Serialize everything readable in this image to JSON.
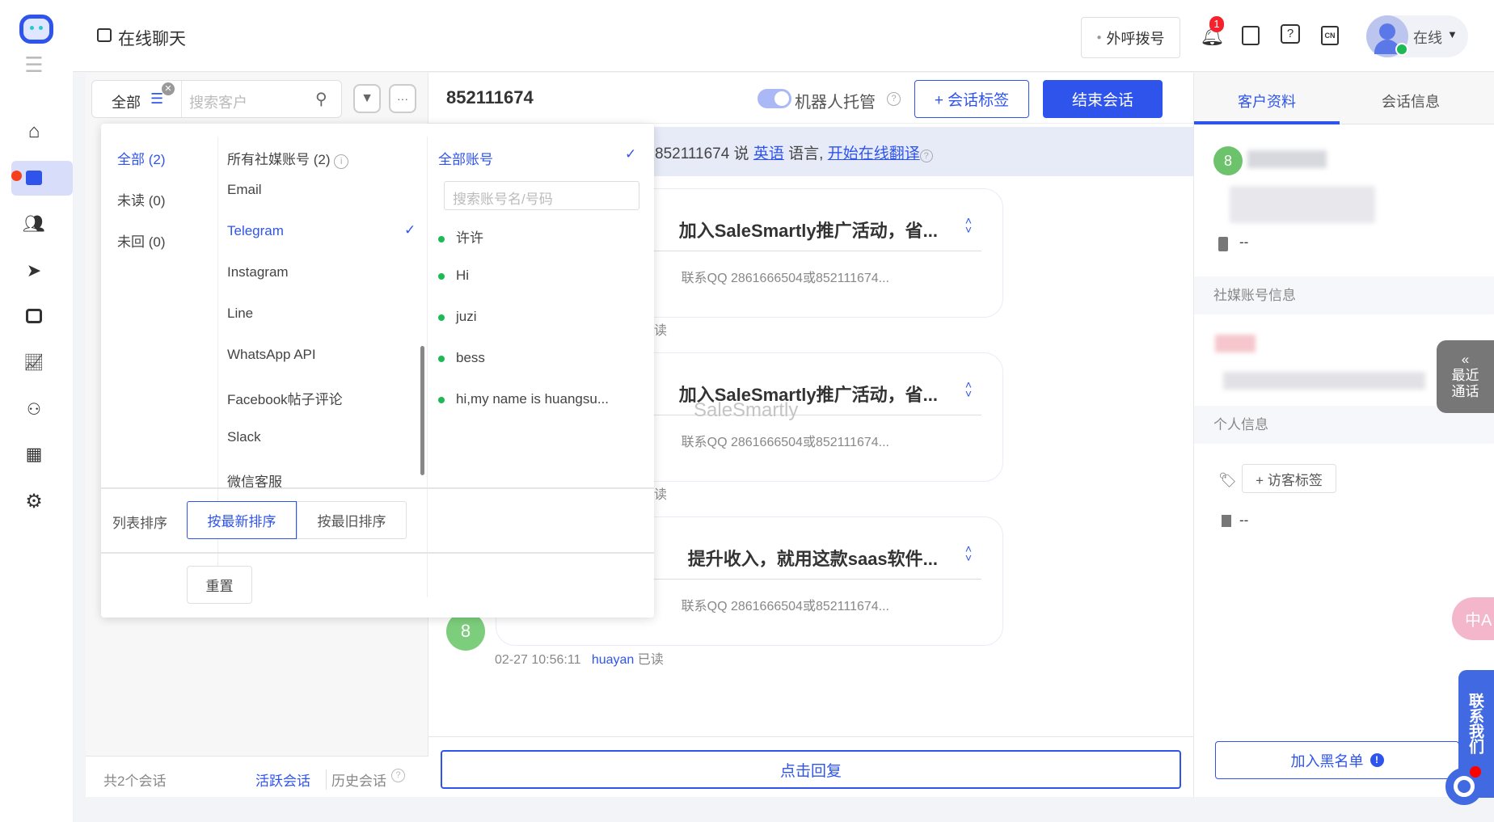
{
  "header": {
    "title": "在线聊天",
    "dial_label": "外呼拨号",
    "notification_count": "1",
    "lang": "CN",
    "status": "在线"
  },
  "nav": {
    "items": [
      "home",
      "chat",
      "contacts",
      "broadcast",
      "bot",
      "analytics",
      "organization",
      "apps",
      "settings"
    ],
    "active": "chat"
  },
  "list": {
    "filter_tab": "全部",
    "search_placeholder": "搜索客户",
    "total": "共2个会话",
    "active_tab": "活跃会话",
    "history_tab": "历史会话"
  },
  "popup": {
    "status_items": [
      "全部 (2)",
      "未读 (0)",
      "未回 (0)"
    ],
    "channels_title": "所有社媒账号 (2)",
    "channels": [
      "Email",
      "Telegram",
      "Instagram",
      "Line",
      "WhatsApp API",
      "Facebook帖子评论",
      "Slack",
      "微信客服"
    ],
    "selected_channel": "Telegram",
    "accounts_title": "全部账号",
    "account_search_placeholder": "搜索账号名/号码",
    "accounts": [
      "许许",
      "Hi",
      "juzi",
      "bess",
      "hi,my name is huangsu..."
    ],
    "sort_label": "列表排序",
    "sort_newest": "按最新排序",
    "sort_oldest": "按最旧排序",
    "reset": "重置"
  },
  "chat": {
    "title": "852111674",
    "bot_label": "机器人托管",
    "bot_enabled": true,
    "tag_button": "+ 会话标签",
    "end_button": "结束会话",
    "banner": {
      "prefix": "852111674 说",
      "lang": "英语",
      "mid": "语言,",
      "link": "开始在线翻译"
    },
    "messages": [
      {
        "title": "加入SaleSmartly推广活动，省...",
        "sub": "联系QQ 2861666504或852111674...",
        "meta_read": "读"
      },
      {
        "title": "加入SaleSmartly推广活动，省...",
        "sub": "联系QQ 2861666504或852111674...",
        "meta_read": "读"
      },
      {
        "title": "提升收入，就用这款saas软件...",
        "sub": "联系QQ 2861666504或852111674...",
        "time": "02-27 10:56:11",
        "agent": "huayan",
        "read": "已读"
      }
    ],
    "avatar": "8",
    "watermark": "SaleSmartly",
    "reply_button": "点击回复"
  },
  "right": {
    "tabs": [
      "客户资料",
      "会话信息"
    ],
    "active_tab": "客户资料",
    "avatar": "8",
    "phone": "--",
    "social_title": "社媒账号信息",
    "personal_title": "个人信息",
    "visitor_tag": "+ 访客标签",
    "note": "--",
    "blacklist": "加入黑名单",
    "recent_calls": "最近通话",
    "contact_us": "联系我们"
  },
  "colors": {
    "accent": "#2f54eb",
    "online": "#1db954",
    "badge": "#f5222d",
    "avatar": "#7ccd7c"
  }
}
